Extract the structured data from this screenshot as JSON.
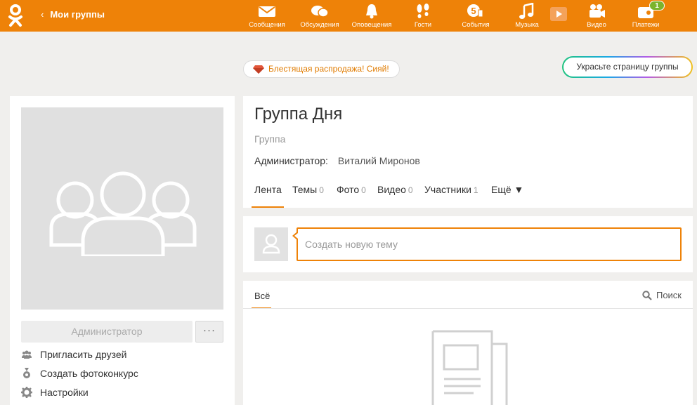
{
  "topbar": {
    "back_label": "Мои группы",
    "nav": [
      {
        "icon": "envelope-icon",
        "label": "Сообщения"
      },
      {
        "icon": "discussions-icon",
        "label": "Обсуждения"
      },
      {
        "icon": "bell-icon",
        "label": "Оповещения"
      },
      {
        "icon": "footprints-icon",
        "label": "Гости"
      },
      {
        "icon": "events-icon",
        "label": "События"
      },
      {
        "icon": "music-note-icon",
        "label": "Музыка"
      },
      {
        "icon": "video-camera-icon",
        "label": "Видео"
      },
      {
        "icon": "wallet-icon",
        "label": "Платежи"
      }
    ],
    "events_badge": "5",
    "payments_badge": "1",
    "colors": {
      "bar": "#ee8208",
      "badge": "#7bb42d"
    }
  },
  "promo": {
    "label": "Блестящая распродажа! Сияй!",
    "decorate_label": "Украсьте страницу группы"
  },
  "sidebar": {
    "admin_button": "Администратор",
    "more_button": "···",
    "links": [
      {
        "icon": "people-icon",
        "label": "Пригласить друзей"
      },
      {
        "icon": "medal-icon",
        "label": "Создать фотоконкурс"
      },
      {
        "icon": "gear-icon",
        "label": "Настройки"
      }
    ]
  },
  "group": {
    "title": "Группа Дня",
    "type": "Группа",
    "admin_label": "Администратор:",
    "admin_name": "Виталий Миронов",
    "tabs": [
      {
        "label": "Лента",
        "count": ""
      },
      {
        "label": "Темы",
        "count": "0"
      },
      {
        "label": "Фото",
        "count": "0"
      },
      {
        "label": "Видео",
        "count": "0"
      },
      {
        "label": "Участники",
        "count": "1"
      },
      {
        "label": "Ещё ▼",
        "count": ""
      }
    ]
  },
  "new_topic": {
    "placeholder": "Создать новую тему"
  },
  "feed": {
    "tab_all": "Всё",
    "search_label": "Поиск"
  }
}
